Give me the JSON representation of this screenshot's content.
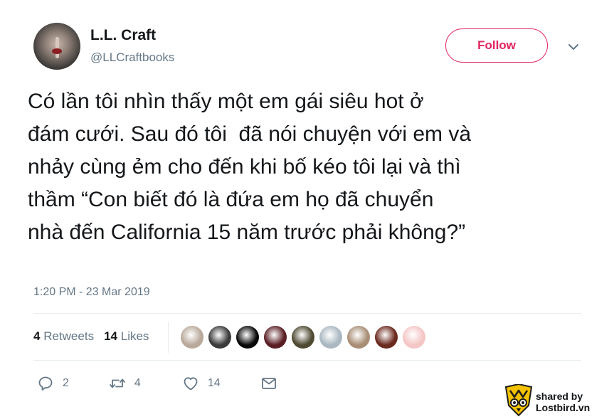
{
  "author": {
    "name": "L.L. Craft",
    "handle": "@LLCraftbooks",
    "avatar_icon": "avatar-photo"
  },
  "follow_button": {
    "label": "Follow",
    "color": "#e0245e"
  },
  "menu": {
    "icon": "chevron-down-icon"
  },
  "tweet": {
    "text": "Có lần tôi nhìn thấy một em gái siêu hot ở\nđám cưới. Sau đó tôi  đã nói chuyện với em và\nnhảy cùng ẻm cho đến khi bố kéo tôi lại và thì\nthầm “Con biết đó là đứa em họ đã chuyển\nnhà đến California 15 năm trước phải không?”",
    "timestamp": "1:20 PM - 23 Mar 2019"
  },
  "stats": {
    "retweets_count": "4",
    "retweets_label": "Retweets",
    "likes_count": "14",
    "likes_label": "Likes"
  },
  "likers": [
    {
      "color": "#b9a99a"
    },
    {
      "color": "#3b3b3b"
    },
    {
      "color": "#0a0a0a"
    },
    {
      "color": "#5a1f24"
    },
    {
      "color": "#4f4a32"
    },
    {
      "color": "#aab8c2"
    },
    {
      "color": "#a98e76"
    },
    {
      "color": "#6b2a1e"
    },
    {
      "color": "#f5c6c6"
    }
  ],
  "actions": {
    "reply_count": "2",
    "retweet_count": "4",
    "like_count": "14"
  },
  "watermark": {
    "line1": "shared by",
    "line2": "Lostbird.vn",
    "colors": {
      "yellow": "#f2c200",
      "dark": "#1d1d1b"
    }
  }
}
